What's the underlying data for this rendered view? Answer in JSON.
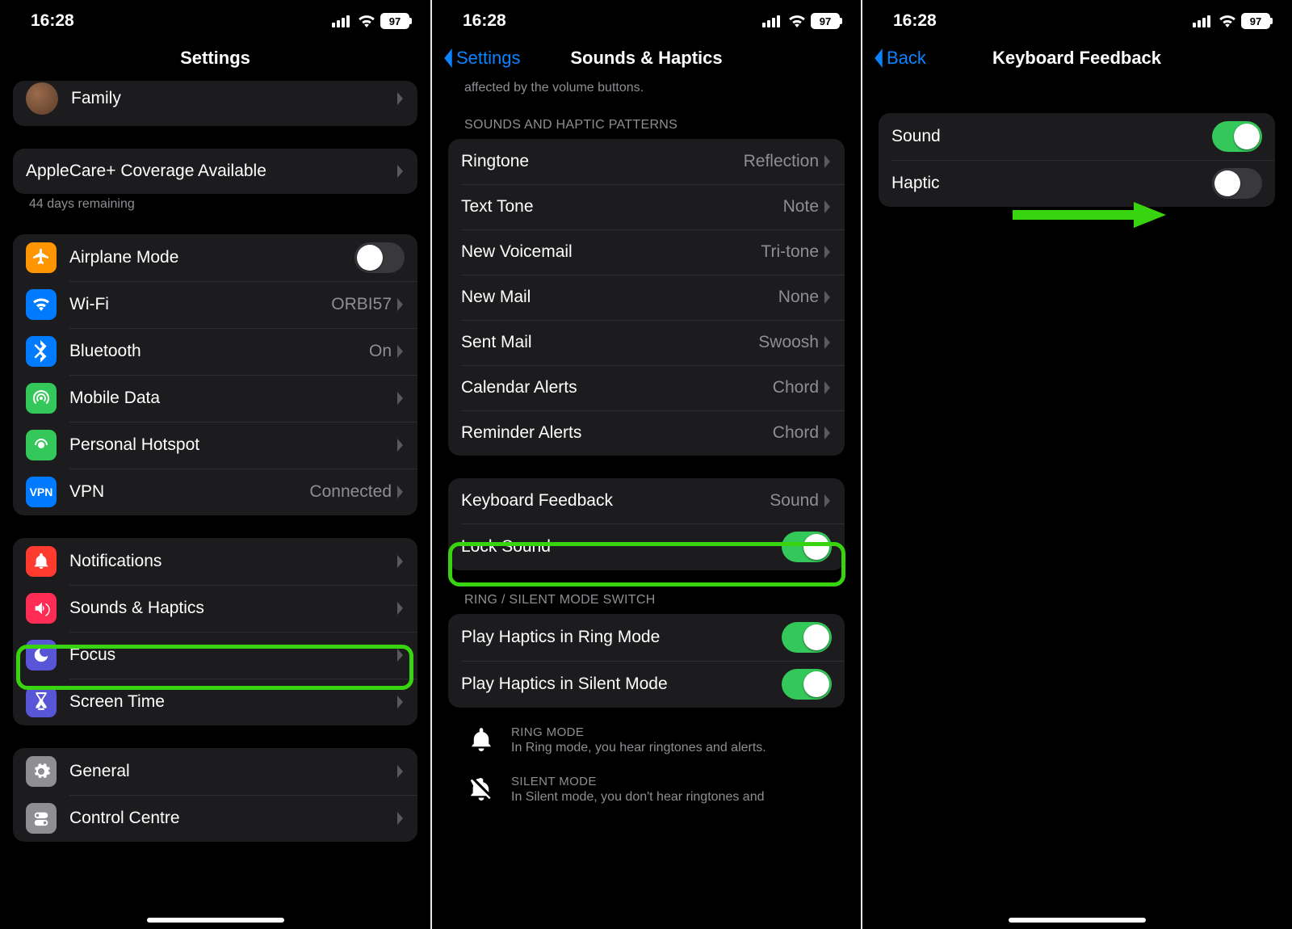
{
  "status": {
    "time": "16:28",
    "battery": "97"
  },
  "screen1": {
    "title": "Settings",
    "familyLabel": "Family",
    "applecare": {
      "label": "AppleCare+ Coverage Available",
      "note": "44 days remaining"
    },
    "netGroup": {
      "airplane": "Airplane Mode",
      "wifi": {
        "label": "Wi-Fi",
        "value": "ORBI57"
      },
      "bt": {
        "label": "Bluetooth",
        "value": "On"
      },
      "mobile": "Mobile Data",
      "hotspot": "Personal Hotspot",
      "vpn": {
        "label": "VPN",
        "value": "Connected"
      }
    },
    "alertsGroup": {
      "notifications": "Notifications",
      "sounds": "Sounds & Haptics",
      "focus": "Focus",
      "screentime": "Screen Time"
    },
    "generalGroup": {
      "general": "General",
      "control": "Control Centre"
    }
  },
  "screen2": {
    "backLabel": "Settings",
    "title": "Sounds & Haptics",
    "topNote": "affected by the volume buttons.",
    "patternsHeader": "SOUNDS AND HAPTIC PATTERNS",
    "patterns": {
      "ringtone": {
        "label": "Ringtone",
        "value": "Reflection"
      },
      "texttone": {
        "label": "Text Tone",
        "value": "Note"
      },
      "voicemail": {
        "label": "New Voicemail",
        "value": "Tri-tone"
      },
      "newmail": {
        "label": "New Mail",
        "value": "None"
      },
      "sentmail": {
        "label": "Sent Mail",
        "value": "Swoosh"
      },
      "calendar": {
        "label": "Calendar Alerts",
        "value": "Chord"
      },
      "reminder": {
        "label": "Reminder Alerts",
        "value": "Chord"
      }
    },
    "kbFeedback": {
      "label": "Keyboard Feedback",
      "value": "Sound"
    },
    "lockSound": "Lock Sound",
    "ringHeader": "RING / SILENT MODE SWITCH",
    "ringHaptics": "Play Haptics in Ring Mode",
    "silentHaptics": "Play Haptics in Silent Mode",
    "ringInfo": {
      "h": "RING MODE",
      "b": "In Ring mode, you hear ringtones and alerts."
    },
    "silentInfo": {
      "h": "SILENT MODE",
      "b": "In Silent mode, you don't hear ringtones and"
    }
  },
  "screen3": {
    "backLabel": "Back",
    "title": "Keyboard Feedback",
    "sound": "Sound",
    "haptic": "Haptic"
  }
}
